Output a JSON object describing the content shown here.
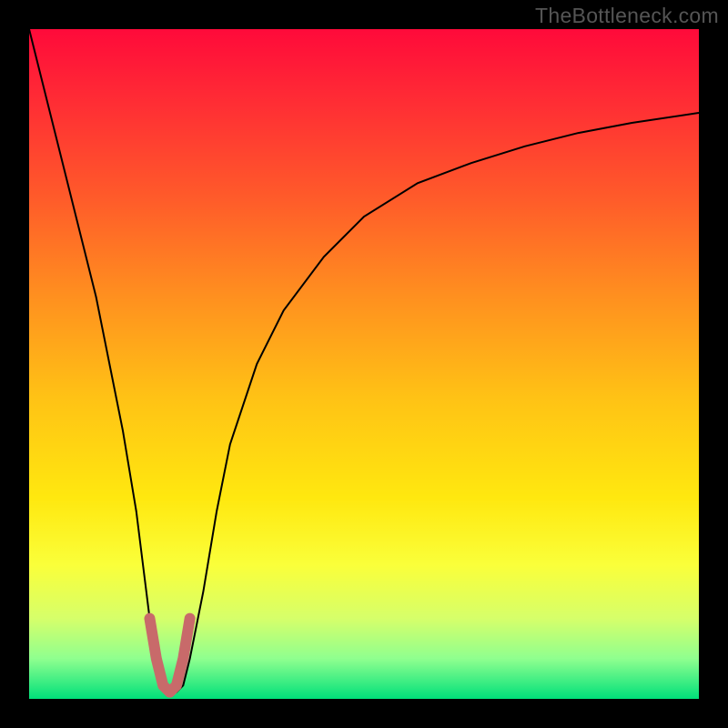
{
  "watermark": "TheBottleneck.com",
  "chart_data": {
    "type": "line",
    "title": "",
    "xlabel": "",
    "ylabel": "",
    "xlim": [
      0,
      100
    ],
    "ylim": [
      0,
      100
    ],
    "grid": false,
    "legend": false,
    "background_gradient": {
      "stops": [
        {
          "offset": 0.0,
          "color": "#ff0a3a"
        },
        {
          "offset": 0.1,
          "color": "#ff2a35"
        },
        {
          "offset": 0.25,
          "color": "#ff5a2a"
        },
        {
          "offset": 0.4,
          "color": "#ff901f"
        },
        {
          "offset": 0.55,
          "color": "#ffc215"
        },
        {
          "offset": 0.7,
          "color": "#ffe80f"
        },
        {
          "offset": 0.8,
          "color": "#faff3a"
        },
        {
          "offset": 0.88,
          "color": "#d6ff6a"
        },
        {
          "offset": 0.94,
          "color": "#8fff8f"
        },
        {
          "offset": 1.0,
          "color": "#00e07a"
        }
      ]
    },
    "series": [
      {
        "name": "bottleneck-curve",
        "color": "#000000",
        "stroke_width": 2,
        "x": [
          0,
          2,
          4,
          6,
          8,
          10,
          12,
          14,
          16,
          18,
          19,
          20,
          21,
          22,
          23,
          24,
          26,
          28,
          30,
          34,
          38,
          44,
          50,
          58,
          66,
          74,
          82,
          90,
          100
        ],
        "y": [
          100,
          92,
          84,
          76,
          68,
          60,
          50,
          40,
          28,
          12,
          6,
          2,
          1,
          1,
          2,
          6,
          16,
          28,
          38,
          50,
          58,
          66,
          72,
          77,
          80,
          82.5,
          84.5,
          86,
          87.5
        ]
      },
      {
        "name": "highlight-u",
        "color": "#c86a6a",
        "stroke_width": 12,
        "linecap": "round",
        "x": [
          18,
          19,
          20,
          21,
          22,
          23,
          24
        ],
        "y": [
          12,
          6,
          2,
          1,
          2,
          6,
          12
        ]
      }
    ]
  }
}
